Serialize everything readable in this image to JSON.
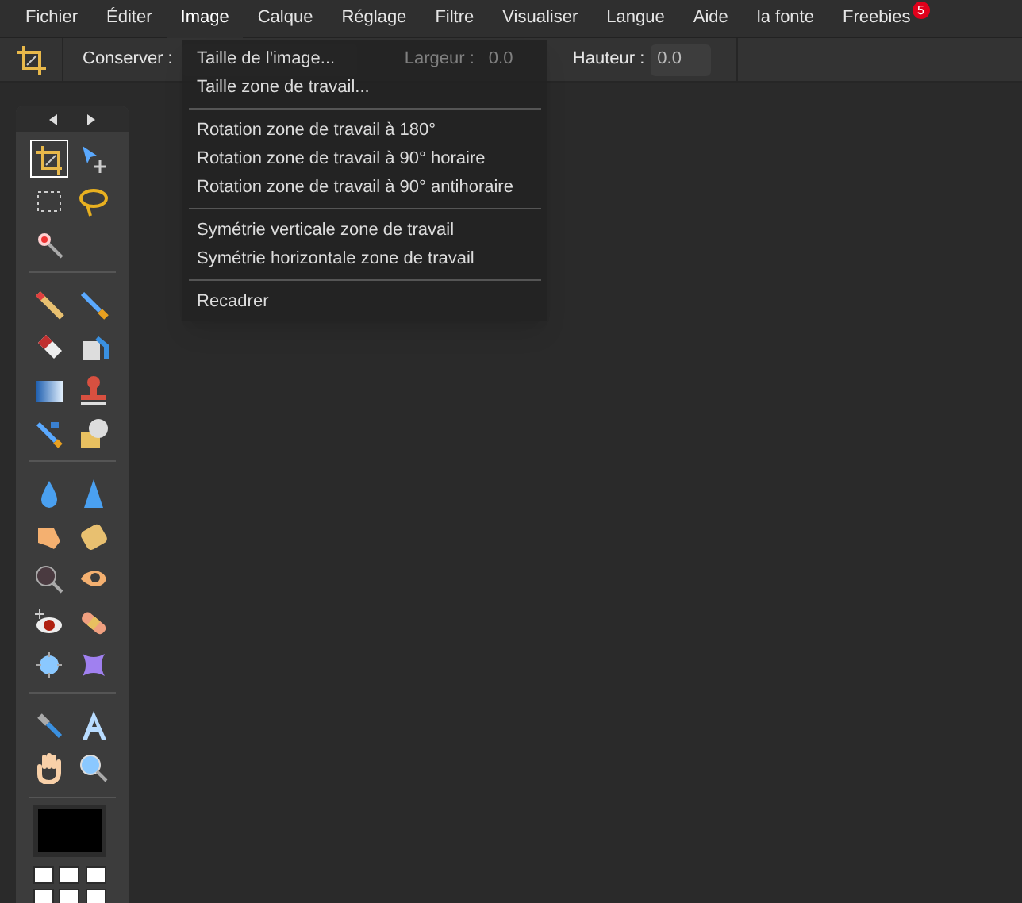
{
  "menubar": [
    {
      "label": "Fichier",
      "selected": false
    },
    {
      "label": "Éditer",
      "selected": false
    },
    {
      "label": "Image",
      "selected": true
    },
    {
      "label": "Calque",
      "selected": false
    },
    {
      "label": "Réglage",
      "selected": false
    },
    {
      "label": "Filtre",
      "selected": false
    },
    {
      "label": "Visualiser",
      "selected": false
    },
    {
      "label": "Langue",
      "selected": false
    },
    {
      "label": "Aide",
      "selected": false
    },
    {
      "label": "la fonte",
      "selected": false
    },
    {
      "label": "Freebies",
      "selected": false,
      "badge": "5"
    }
  ],
  "options_bar": {
    "keep_label": "Conserver :",
    "width_label": "Largeur :",
    "width_value": "0.0",
    "width_disabled": true,
    "height_label": "Hauteur :",
    "height_value": "0.0"
  },
  "image_menu": [
    [
      "Taille de l'image...",
      "Taille zone de travail..."
    ],
    [
      "Rotation zone de travail à 180°",
      "Rotation zone de travail à 90° horaire",
      "Rotation zone de travail à 90° antihoraire"
    ],
    [
      "Symétrie verticale zone de travail",
      "Symétrie horizontale zone de travail"
    ],
    [
      "Recadrer"
    ]
  ],
  "tools": [
    [
      {
        "selected": true
      },
      {
        "selected": false
      },
      {
        "selected": false
      },
      {
        "selected": false
      },
      {
        "selected": false
      }
    ],
    [
      {
        "selected": false
      },
      {
        "selected": false
      },
      {
        "selected": false
      },
      {
        "selected": false
      },
      {
        "selected": false
      },
      {
        "selected": false
      },
      {
        "selected": false
      },
      {
        "selected": false
      }
    ],
    [
      {
        "selected": false
      },
      {
        "selected": false
      },
      {
        "selected": false
      },
      {
        "selected": false
      },
      {
        "selected": false
      },
      {
        "selected": false
      },
      {
        "selected": false
      },
      {
        "selected": false
      },
      {
        "selected": false
      },
      {
        "selected": false
      }
    ],
    [
      {
        "selected": false
      },
      {
        "selected": false
      },
      {
        "selected": false
      },
      {
        "selected": false
      }
    ]
  ]
}
